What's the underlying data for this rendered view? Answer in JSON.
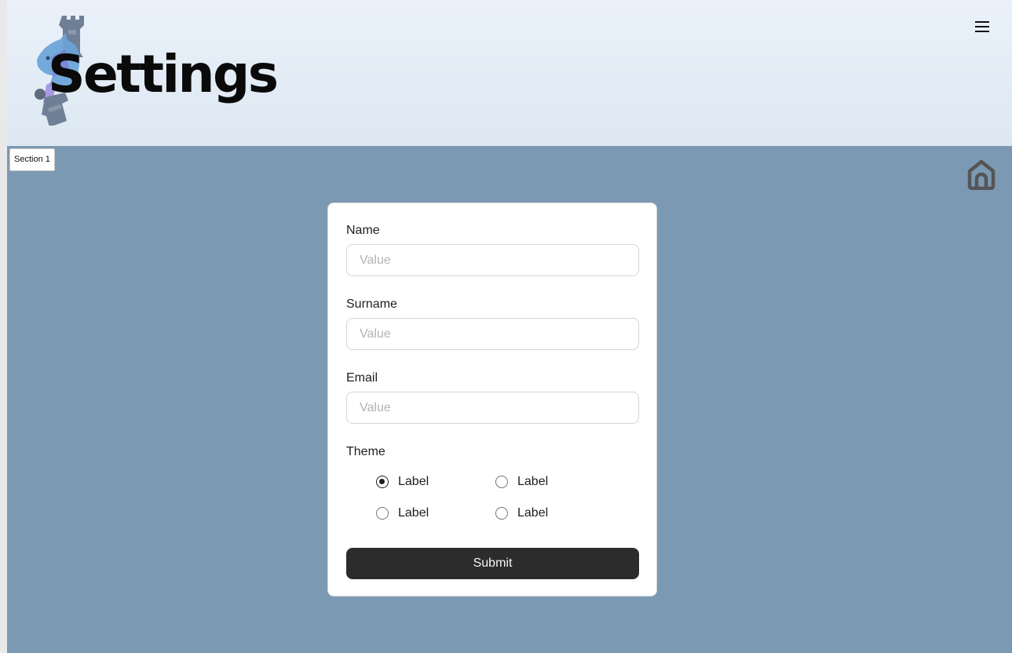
{
  "header": {
    "title": "Settings",
    "logo_icon": "chess-pieces-logo-icon",
    "menu_icon": "hamburger-menu-icon"
  },
  "main": {
    "section_tab": "Section 1",
    "home_icon": "home-icon",
    "background_color": "#7b99b2"
  },
  "form": {
    "name": {
      "label": "Name",
      "placeholder": "Value"
    },
    "surname": {
      "label": "Surname",
      "placeholder": "Value"
    },
    "email": {
      "label": "Email",
      "placeholder": "Value"
    },
    "theme": {
      "label": "Theme",
      "options": [
        {
          "label": "Label",
          "checked": true
        },
        {
          "label": "Label",
          "checked": false
        },
        {
          "label": "Label",
          "checked": false
        },
        {
          "label": "Label",
          "checked": false
        }
      ]
    },
    "submit_label": "Submit"
  },
  "colors": {
    "header_gradient_top": "#eaf1fa",
    "header_gradient_bottom": "#dde8f2",
    "button_bg": "#2c2c2c"
  }
}
